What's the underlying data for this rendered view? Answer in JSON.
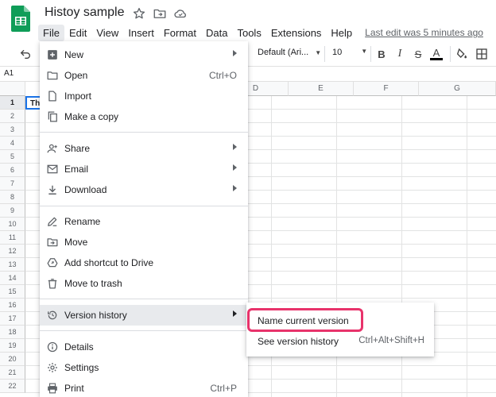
{
  "doc": {
    "title": "Histoy sample",
    "last_edit": "Last edit was 5 minutes ago"
  },
  "menubar": [
    "File",
    "Edit",
    "View",
    "Insert",
    "Format",
    "Data",
    "Tools",
    "Extensions",
    "Help"
  ],
  "toolbar": {
    "font": "Default (Ari...",
    "font_size": "10"
  },
  "name_box": "A1",
  "grid": {
    "columns": [
      "D",
      "E",
      "F",
      "G"
    ],
    "rows": [
      "1",
      "2",
      "3",
      "4",
      "5",
      "6",
      "7",
      "8",
      "9",
      "10",
      "11",
      "12",
      "13",
      "14",
      "15",
      "16",
      "17",
      "18",
      "19",
      "20",
      "21",
      "22"
    ],
    "cell_a1": "Th"
  },
  "file_menu": {
    "items": [
      {
        "label": "New",
        "icon": "new-sheet-icon",
        "submenu": true
      },
      {
        "label": "Open",
        "icon": "folder-icon",
        "shortcut": "Ctrl+O"
      },
      {
        "label": "Import",
        "icon": "import-file-icon"
      },
      {
        "label": "Make a copy",
        "icon": "copy-icon"
      },
      {
        "label": "Share",
        "icon": "person-add-icon",
        "submenu": true
      },
      {
        "label": "Email",
        "icon": "email-icon",
        "submenu": true
      },
      {
        "label": "Download",
        "icon": "download-icon",
        "submenu": true
      },
      {
        "label": "Rename",
        "icon": "pencil-icon"
      },
      {
        "label": "Move",
        "icon": "move-folder-icon"
      },
      {
        "label": "Add shortcut to Drive",
        "icon": "drive-shortcut-icon"
      },
      {
        "label": "Move to trash",
        "icon": "trash-icon"
      },
      {
        "label": "Version history",
        "icon": "history-icon",
        "submenu": true
      },
      {
        "label": "Details",
        "icon": "info-icon"
      },
      {
        "label": "Settings",
        "icon": "gear-icon"
      },
      {
        "label": "Print",
        "icon": "print-icon",
        "shortcut": "Ctrl+P"
      }
    ]
  },
  "version_submenu": {
    "items": [
      {
        "label": "Name current version"
      },
      {
        "label": "See version history",
        "shortcut": "Ctrl+Alt+Shift+H"
      }
    ]
  },
  "colors": {
    "highlight": "#e8336b",
    "sheets_green": "#0f9d58",
    "menu_hover": "#e8eaed"
  }
}
